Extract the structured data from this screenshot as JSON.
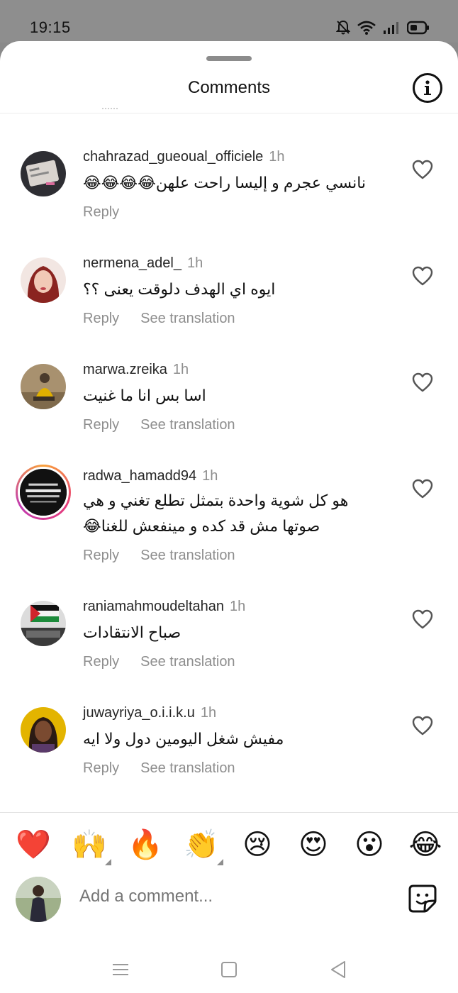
{
  "status_bar": {
    "time": "19:15",
    "icons": [
      "mute-bell-icon",
      "wifi-icon",
      "signal-icon",
      "battery-icon"
    ]
  },
  "header": {
    "title": "Comments",
    "info_icon": "info-icon"
  },
  "comments": [
    {
      "username": "chahrazad_gueoual_officiele",
      "time": "1h",
      "text": "نانسي عجرم و إليسا راحت علهن😂😂😂😂",
      "reply_label": "Reply",
      "translate_label": ""
    },
    {
      "username": "nermena_adel_",
      "time": "1h",
      "text": "ايوه اي الهدف دلوقت يعنى ؟؟",
      "reply_label": "Reply",
      "translate_label": "See translation"
    },
    {
      "username": "marwa.zreika",
      "time": "1h",
      "text": "اسا بس انا ما غنيت",
      "reply_label": "Reply",
      "translate_label": "See translation"
    },
    {
      "username": "radwa_hamadd94",
      "time": "1h",
      "text": "هو كل شوية واحدة بتمثل تطلع تغني و هي صوتها مش قد كده و مينفعش للغنا😂",
      "reply_label": "Reply",
      "translate_label": "See translation"
    },
    {
      "username": "raniamahmoudeltahan",
      "time": "1h",
      "text": "صباح الانتقادات",
      "reply_label": "Reply",
      "translate_label": "See translation"
    },
    {
      "username": "juwayriya_o.i.i.k.u",
      "time": "1h",
      "text": "مفيش شغل اليومين دول ولا ايه",
      "reply_label": "Reply",
      "translate_label": "See translation"
    }
  ],
  "reactions": [
    "❤️",
    "🙌",
    "🔥",
    "👏",
    "😢",
    "😍",
    "😮",
    "😂"
  ],
  "composer": {
    "placeholder": "Add a comment...",
    "sticker_icon": "sticker-icon"
  },
  "nav": [
    "menu-icon",
    "home-square-icon",
    "back-triangle-icon"
  ],
  "colors": {
    "secondary_text": "#8e8e8e",
    "heart_red": "#e0202a",
    "story_ring_start": "#f9a13a",
    "story_ring_end": "#c13bb0"
  }
}
